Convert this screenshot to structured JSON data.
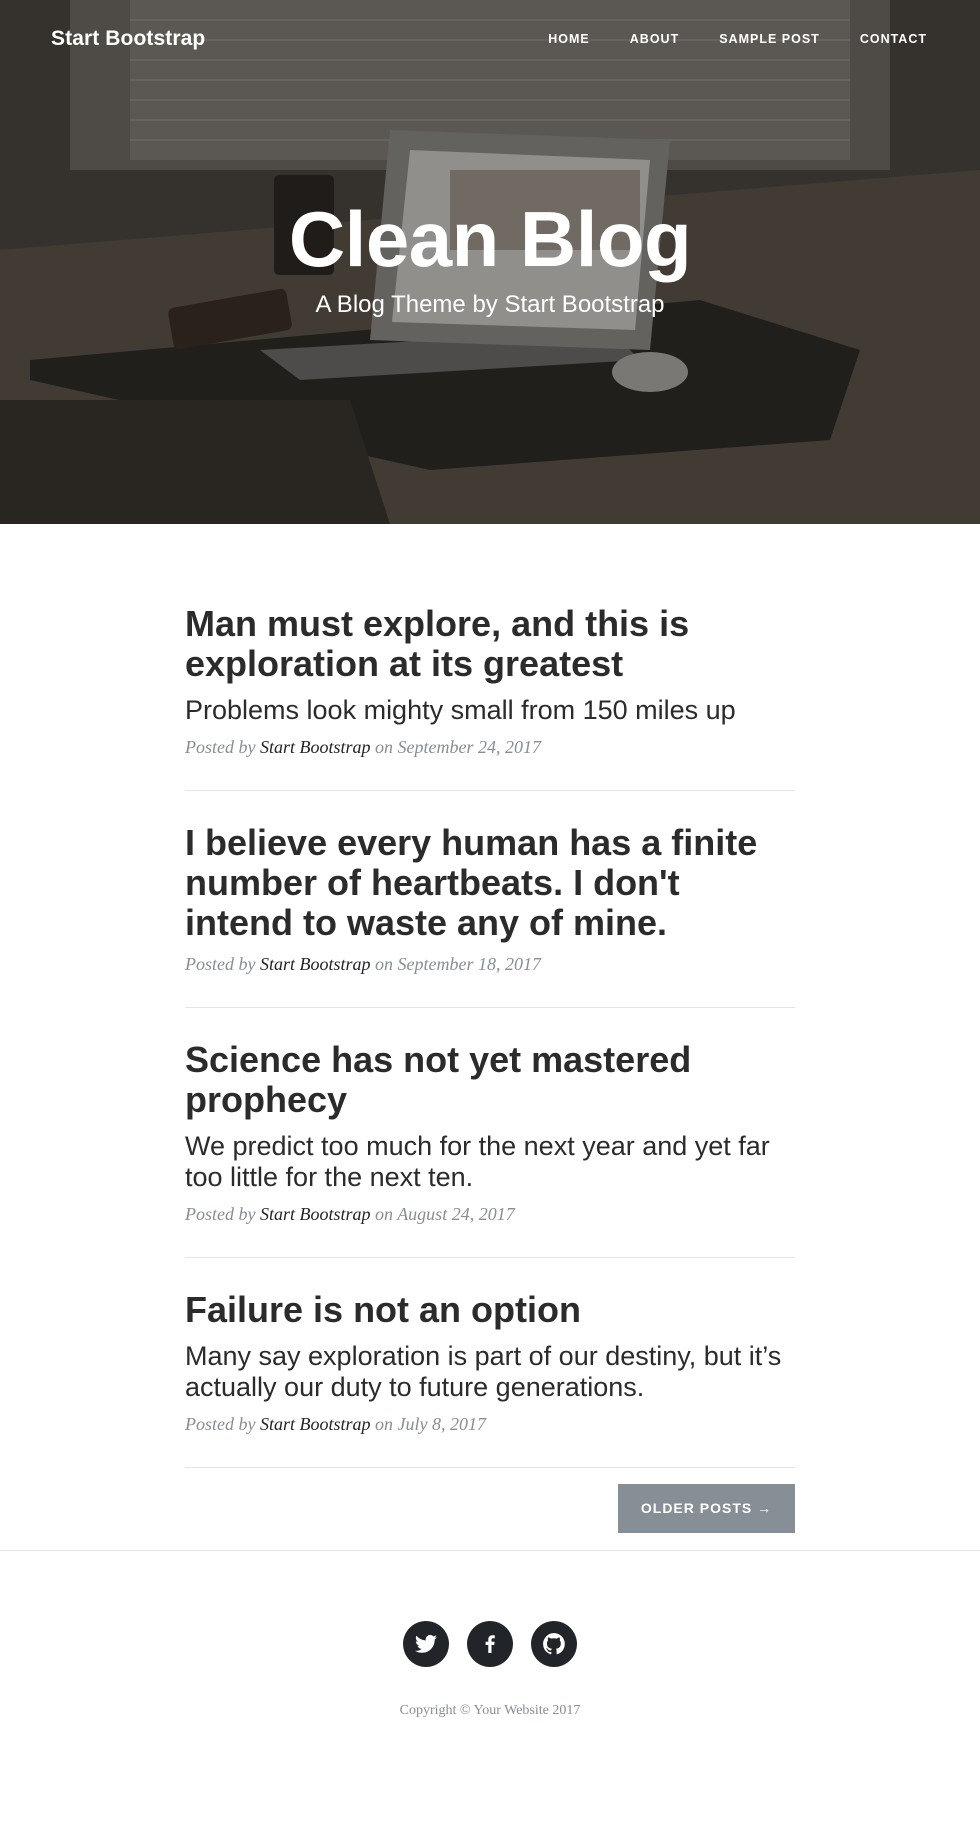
{
  "nav": {
    "brand": "Start Bootstrap",
    "links": [
      "Home",
      "About",
      "Sample Post",
      "Contact"
    ]
  },
  "hero": {
    "title": "Clean Blog",
    "subtitle": "A Blog Theme by Start Bootstrap"
  },
  "posts": [
    {
      "title": "Man must explore, and this is exploration at its greatest",
      "subtitle": "Problems look mighty small from 150 miles up",
      "meta_prefix": "Posted by",
      "author": "Start Bootstrap",
      "meta_mid": "on",
      "date": "September 24, 2017"
    },
    {
      "title": "I believe every human has a finite number of heartbeats. I don't intend to waste any of mine.",
      "subtitle": "",
      "meta_prefix": "Posted by",
      "author": "Start Bootstrap",
      "meta_mid": "on",
      "date": "September 18, 2017"
    },
    {
      "title": "Science has not yet mastered prophecy",
      "subtitle": "We predict too much for the next year and yet far too little for the next ten.",
      "meta_prefix": "Posted by",
      "author": "Start Bootstrap",
      "meta_mid": "on",
      "date": "August 24, 2017"
    },
    {
      "title": "Failure is not an option",
      "subtitle": "Many say exploration is part of our destiny, but it’s actually our duty to future generations.",
      "meta_prefix": "Posted by",
      "author": "Start Bootstrap",
      "meta_mid": "on",
      "date": "July 8, 2017"
    }
  ],
  "pager": {
    "older_label": "Older Posts →"
  },
  "footer": {
    "social_icons": [
      "twitter-icon",
      "facebook-icon",
      "github-icon"
    ],
    "copyright": "Copyright © Your Website 2017"
  },
  "colors": {
    "text": "#212529",
    "muted": "#868e96",
    "button": "#868e96",
    "divider": "#e5e5e5"
  }
}
